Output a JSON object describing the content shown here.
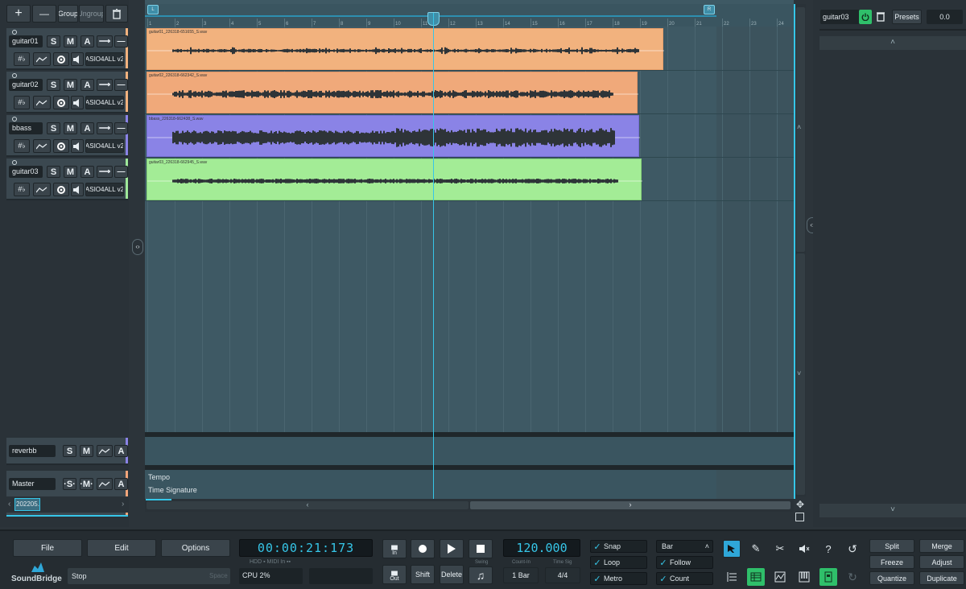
{
  "toolbar": {
    "add": "+",
    "remove": "—",
    "group": "Group",
    "ungroup": "Ungroup",
    "delete_icon": "trash-icon"
  },
  "tracks": [
    {
      "name": "guitar01",
      "color": "#f2b27e",
      "input": "ASIO4ALL v2"
    },
    {
      "name": "guitar02",
      "color": "#f2b27e",
      "input": "ASIO4ALL v2"
    },
    {
      "name": "bbass",
      "color": "#8a83e6",
      "input": "ASIO4ALL v2"
    },
    {
      "name": "guitar03",
      "color": "#9fe89a",
      "input": "ASIO4ALL v2"
    }
  ],
  "track_buttons": {
    "solo": "S",
    "mute": "M",
    "auto": "A",
    "route": "⟶",
    "collapse": "—",
    "tuner": "#♭"
  },
  "return_track": {
    "name": "reverbb",
    "solo": "S",
    "mute": "M",
    "auto": "A"
  },
  "master_track": {
    "name": "Master",
    "solo": "·S·",
    "mute": "·M·",
    "auto": "A",
    "tab": "202205..."
  },
  "ruler": {
    "numbers": [
      "1",
      "2",
      "3",
      "4",
      "5",
      "6",
      "7",
      "8",
      "9",
      "10",
      "11",
      "12",
      "13",
      "14",
      "15",
      "16",
      "17",
      "18",
      "19",
      "20",
      "21",
      "22",
      "23",
      "24"
    ],
    "loop_start": "L",
    "loop_end": "R"
  },
  "clips": [
    {
      "name": "guitar01_226318-651655_S.wav",
      "color": "#f2b27e",
      "border": "#e9a06a"
    },
    {
      "name": "guitar02_226318-662342_S.wav",
      "color": "#f0a97a",
      "border": "#e39767"
    },
    {
      "name": "bbass_226318-662438_S.wav",
      "color": "#8a83e6",
      "border": "#7770d8"
    },
    {
      "name": "guitar03_226318-662945_S.wav",
      "color": "#a3ec96",
      "border": "#86d479"
    }
  ],
  "global_tracks": {
    "tempo": "Tempo",
    "time_signature": "Time Signature"
  },
  "right_panel": {
    "track_name": "guitar03",
    "presets": "Presets",
    "value": "0.0"
  },
  "transport": {
    "file": "File",
    "edit": "Edit",
    "options": "Options",
    "logo": "SoundBridge",
    "status": "Stop",
    "status_hint": "Space",
    "time": "00:00:21:173",
    "hdd": "HDD",
    "midi_in": "MIDI In",
    "cpu": "CPU 2%",
    "in": "In",
    "out": "Out",
    "shift": "Shift",
    "delete": "Delete",
    "swing": "Swing",
    "tempo": "120.000",
    "count_in_label": "Count-In",
    "time_sig_label": "Time Sig",
    "count_in": "1 Bar",
    "time_sig": "4/4",
    "snap": "Snap",
    "loop": "Loop",
    "metro": "Metro",
    "grid": "Bar",
    "follow": "Follow",
    "count": "Count",
    "split": "Split",
    "merge": "Merge",
    "freeze": "Freeze",
    "adjust": "Adjust",
    "quantize": "Quantize",
    "duplicate": "Duplicate",
    "help": "?"
  }
}
